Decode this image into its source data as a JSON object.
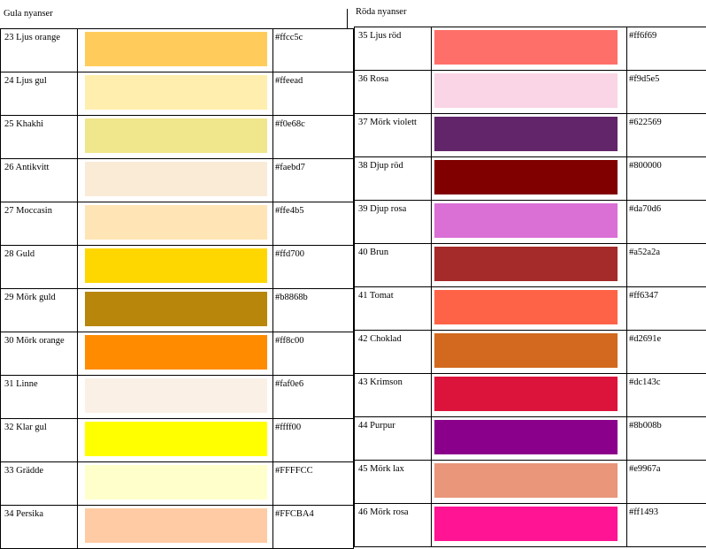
{
  "left": {
    "title": "Gula nyanser",
    "rows": [
      {
        "name": "23 Ljus orange",
        "hex": "#ffcc5c",
        "color": "#ffcc5c"
      },
      {
        "name": "24 Ljus gul",
        "hex": "#ffeead",
        "color": "#ffeead"
      },
      {
        "name": "25 Khakhi",
        "hex": "#f0e68c",
        "color": "#f0e68c"
      },
      {
        "name": "26 Antikvitt",
        "hex": "#faebd7",
        "color": "#faebd7"
      },
      {
        "name": "27 Moccasin",
        "hex": "#ffe4b5",
        "color": "#ffe4b5"
      },
      {
        "name": "28 Guld",
        "hex": "#ffd700",
        "color": "#ffd700"
      },
      {
        "name": "29 Mörk guld",
        "hex": "#b8868b",
        "color": "#b8860b"
      },
      {
        "name": "30 Mörk orange",
        "hex": "#ff8c00",
        "color": "#ff8c00"
      },
      {
        "name": "31 Linne",
        "hex": "#faf0e6",
        "color": "#faf0e6"
      },
      {
        "name": "32 Klar gul",
        "hex": "#ffff00",
        "color": "#ffff00"
      },
      {
        "name": "33 Grädde",
        "hex": "#FFFFCC",
        "color": "#ffffcc"
      },
      {
        "name": "34 Persika",
        "hex": "#FFCBA4",
        "color": "#ffcba4"
      }
    ]
  },
  "right": {
    "title": "Röda nyanser",
    "rows": [
      {
        "name": "35 Ljus röd",
        "hex": "#ff6f69",
        "color": "#ff6f69"
      },
      {
        "name": "36 Rosa",
        "hex": "#f9d5e5",
        "color": "#f9d5e5"
      },
      {
        "name": "37 Mörk violett",
        "hex": "#622569",
        "color": "#622569"
      },
      {
        "name": "38 Djup röd",
        "hex": "#800000",
        "color": "#800000"
      },
      {
        "name": "39 Djup rosa",
        "hex": "#da70d6",
        "color": "#da70d6"
      },
      {
        "name": "40 Brun",
        "hex": "#a52a2a",
        "color": "#a52a2a"
      },
      {
        "name": "41 Tomat",
        "hex": "#ff6347",
        "color": "#ff6347"
      },
      {
        "name": "42 Choklad",
        "hex": "#d2691e",
        "color": "#d2691e"
      },
      {
        "name": "43 Krimson",
        "hex": "#dc143c",
        "color": "#dc143c"
      },
      {
        "name": "44 Purpur",
        "hex": "#8b008b",
        "color": "#8b008b"
      },
      {
        "name": "45 Mörk lax",
        "hex": "#e9967a",
        "color": "#e9967a"
      },
      {
        "name": "46 Mörk rosa",
        "hex": "#ff1493",
        "color": "#ff1493"
      }
    ]
  }
}
